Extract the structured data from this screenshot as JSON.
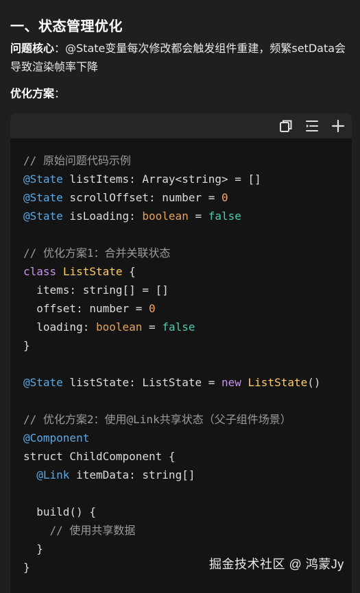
{
  "article": {
    "heading": "一、状态管理优化",
    "problem_label": "问题核心",
    "problem_text": "：@State变量每次修改都会触发组件重建，频繁setData会导致渲染帧率下降",
    "solution_label": "优化方案",
    "solution_colon": "："
  },
  "code_toolbar": {
    "icons": [
      "copy-icon",
      "list-icon",
      "plus-icon"
    ]
  },
  "code_lines": [
    [
      {
        "t": "// 原始问题代码示例",
        "c": "cm"
      }
    ],
    [
      {
        "t": "@State",
        "c": "dec"
      },
      {
        "t": " listItems: Array<string> = []",
        "c": "pl"
      }
    ],
    [
      {
        "t": "@State",
        "c": "dec"
      },
      {
        "t": " scrollOffset: number = ",
        "c": "pl"
      },
      {
        "t": "0",
        "c": "num"
      }
    ],
    [
      {
        "t": "@State",
        "c": "dec"
      },
      {
        "t": " isLoading: ",
        "c": "pl"
      },
      {
        "t": "boolean",
        "c": "typ"
      },
      {
        "t": " = ",
        "c": "pl"
      },
      {
        "t": "false",
        "c": "lit"
      }
    ],
    [],
    [
      {
        "t": "// 优化方案1：合并关联状态",
        "c": "cm"
      }
    ],
    [
      {
        "t": "class",
        "c": "kw"
      },
      {
        "t": " ",
        "c": "pl"
      },
      {
        "t": "ListState",
        "c": "cls"
      },
      {
        "t": " {",
        "c": "pl"
      }
    ],
    [
      {
        "t": "  items: string[] = []",
        "c": "pl"
      }
    ],
    [
      {
        "t": "  offset: number = ",
        "c": "pl"
      },
      {
        "t": "0",
        "c": "num"
      }
    ],
    [
      {
        "t": "  loading: ",
        "c": "pl"
      },
      {
        "t": "boolean",
        "c": "typ"
      },
      {
        "t": " = ",
        "c": "pl"
      },
      {
        "t": "false",
        "c": "lit"
      }
    ],
    [
      {
        "t": "}",
        "c": "pl"
      }
    ],
    [],
    [
      {
        "t": "@State",
        "c": "dec"
      },
      {
        "t": " listState: ListState = ",
        "c": "pl"
      },
      {
        "t": "new",
        "c": "kw"
      },
      {
        "t": " ",
        "c": "pl"
      },
      {
        "t": "ListState",
        "c": "cls"
      },
      {
        "t": "()",
        "c": "pl"
      }
    ],
    [],
    [
      {
        "t": "// 优化方案2：使用@Link共享状态（父子组件场景）",
        "c": "cm"
      }
    ],
    [
      {
        "t": "@Component",
        "c": "dec"
      }
    ],
    [
      {
        "t": "struct ChildComponent {",
        "c": "pl"
      }
    ],
    [
      {
        "t": "  ",
        "c": "pl"
      },
      {
        "t": "@Link",
        "c": "dec"
      },
      {
        "t": " itemData: string[]",
        "c": "pl"
      }
    ],
    [],
    [
      {
        "t": "  build() {",
        "c": "pl"
      }
    ],
    [
      {
        "t": "    // 使用共享数据",
        "c": "cm"
      }
    ],
    [
      {
        "t": "  }",
        "c": "pl"
      }
    ],
    [
      {
        "t": "}",
        "c": "pl"
      }
    ]
  ],
  "watermark": "掘金技术社区 @ 鸿蒙Jy"
}
